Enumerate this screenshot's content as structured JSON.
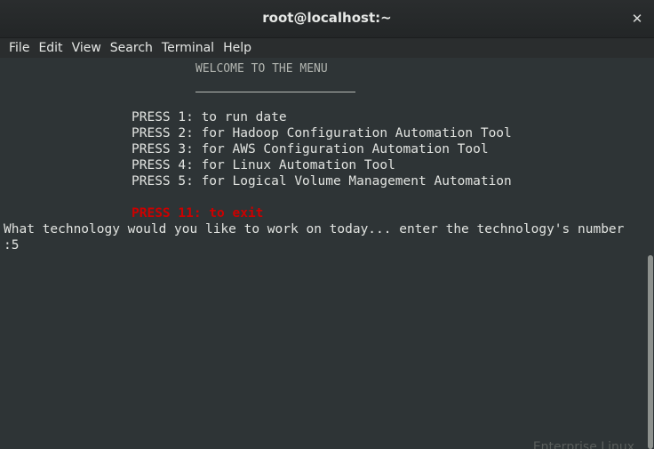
{
  "window": {
    "title": "root@localhost:~",
    "close_glyph": "✕"
  },
  "menubar": {
    "items": [
      "File",
      "Edit",
      "View",
      "Search",
      "Terminal",
      "Help"
    ]
  },
  "terminal": {
    "welcome": "WELCOME TO THE MENU",
    "options": [
      "PRESS 1: to run date",
      "PRESS 2: for Hadoop Configuration Automation Tool",
      "PRESS 3: for AWS Configuration Automation Tool",
      "PRESS 4: for Linux Automation Tool",
      "PRESS 5: for Logical Volume Management Automation"
    ],
    "exit_option": "PRESS 11: to exit",
    "prompt": "What technology would you like to work on today... enter the technology's number",
    "input": ":5",
    "exit_color": "#cc0000",
    "background_color": "#2e3436"
  },
  "watermark": "Enterprise Linux"
}
